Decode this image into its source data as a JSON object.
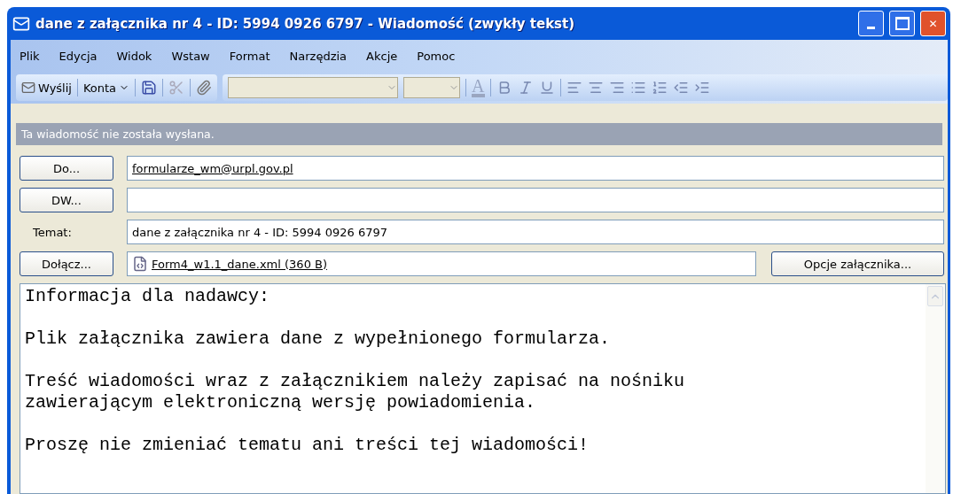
{
  "window": {
    "title": "dane z załącznika nr 4 - ID: 5994 0926 6797 - Wiadomość (zwykły tekst)"
  },
  "menu": [
    "Plik",
    "Edycja",
    "Widok",
    "Wstaw",
    "Format",
    "Narzędzia",
    "Akcje",
    "Pomoc"
  ],
  "toolbar": {
    "send": "Wyślij",
    "accounts": "Konta"
  },
  "info_bar": "Ta wiadomość nie została wysłana.",
  "fields": [
    {
      "kind": "button",
      "label": "Do...",
      "value": "formularze_wm@urpl.gov.pl",
      "link": true
    },
    {
      "kind": "button",
      "label": "DW..."
    },
    {
      "kind": "label",
      "label": "Temat:",
      "value": "dane z załącznika nr 4 - ID: 5994 0926 6797",
      "link": false
    }
  ],
  "attach": {
    "button": "Dołącz...",
    "file": "Form4_w1.1_dane.xml (360 B)",
    "options": "Opcje załącznika..."
  },
  "window_controls": {
    "close": "✕"
  },
  "format_toolbar": {
    "font_color": "A"
  },
  "body": [
    [
      "Informacja dla nadawcy:"
    ],
    [
      "Plik załącznika zawiera dane z wypełnionego formularza."
    ],
    [
      "Treść wiadomości wraz z załącznikiem należy zapisać na nośniku",
      "zawierającym elektroniczną wersję powiadomienia."
    ],
    [
      "Proszę nie zmieniać tematu ani treści tej wiadomości!"
    ]
  ]
}
